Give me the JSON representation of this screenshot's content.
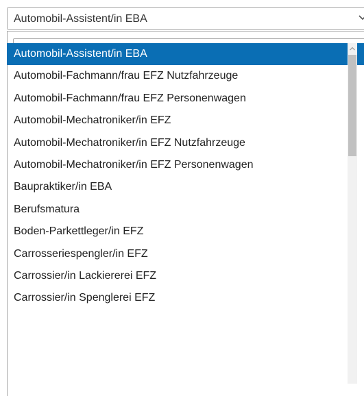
{
  "select": {
    "value": "Automobil-Assistent/in EBA",
    "icon": "chevron-down-icon"
  },
  "search": {
    "value": "",
    "placeholder": "",
    "icon": "search-icon"
  },
  "options": [
    {
      "label": "Automobil-Assistent/in EBA",
      "selected": true
    },
    {
      "label": "Automobil-Fachmann/frau EFZ Nutzfahrzeuge",
      "selected": false
    },
    {
      "label": "Automobil-Fachmann/frau EFZ Personenwagen",
      "selected": false
    },
    {
      "label": "Automobil-Mechatroniker/in EFZ",
      "selected": false
    },
    {
      "label": "Automobil-Mechatroniker/in EFZ Nutzfahrzeuge",
      "selected": false
    },
    {
      "label": "Automobil-Mechatroniker/in EFZ Personenwagen",
      "selected": false
    },
    {
      "label": "Baupraktiker/in EBA",
      "selected": false
    },
    {
      "label": "Berufsmatura",
      "selected": false
    },
    {
      "label": "Boden-Parkettleger/in EFZ",
      "selected": false
    },
    {
      "label": "Carrosseriespengler/in EFZ",
      "selected": false
    },
    {
      "label": "Carrossier/in Lackiererei EFZ",
      "selected": false
    },
    {
      "label": "Carrossier/in Spenglerei EFZ",
      "selected": false
    }
  ],
  "colors": {
    "selected_background": "#0a6eb4",
    "selected_text": "#ffffff",
    "border": "#a9a9a9"
  }
}
